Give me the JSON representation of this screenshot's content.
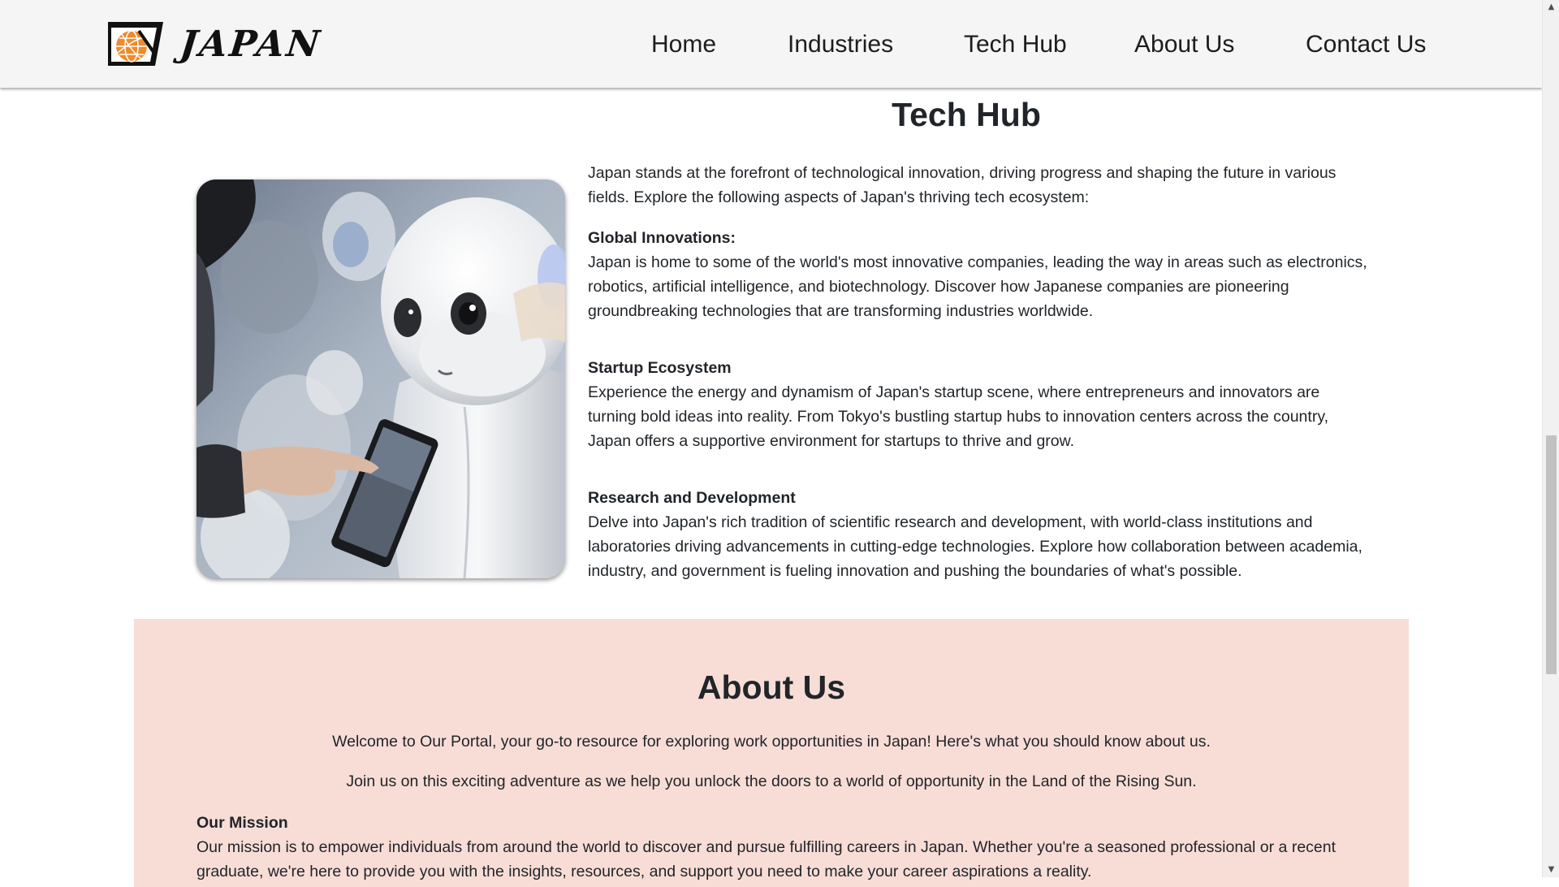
{
  "brand": {
    "name": "JAPAN",
    "logo_icon": "globe-logo-icon"
  },
  "nav": {
    "items": [
      {
        "label": "Home"
      },
      {
        "label": "Industries"
      },
      {
        "label": "Tech Hub"
      },
      {
        "label": "About Us"
      },
      {
        "label": "Contact Us"
      }
    ]
  },
  "tech_hub": {
    "title": "Tech Hub",
    "image_icon": "robot-photo",
    "intro": "Japan stands at the forefront of technological innovation, driving progress and shaping the future in various fields. Explore the following aspects of Japan's thriving tech ecosystem:",
    "features": [
      {
        "title": "Global Innovations:",
        "text": "Japan is home to some of the world's most innovative companies, leading the way in areas such as electronics, robotics, artificial intelligence, and biotechnology. Discover how Japanese companies are pioneering groundbreaking technologies that are transforming industries worldwide."
      },
      {
        "title": "Startup Ecosystem",
        "text": "Experience the energy and dynamism of Japan's startup scene, where entrepreneurs and innovators are turning bold ideas into reality. From Tokyo's bustling startup hubs to innovation centers across the country, Japan offers a supportive environment for startups to thrive and grow."
      },
      {
        "title": "Research and Development",
        "text": "Delve into Japan's rich tradition of scientific research and development, with world-class institutions and laboratories driving advancements in cutting-edge technologies. Explore how collaboration between academia, industry, and government is fueling innovation and pushing the boundaries of what's possible."
      }
    ]
  },
  "about": {
    "title": "About Us",
    "welcome": "Welcome to Our Portal, your go-to resource for exploring work opportunities in Japan! Here's what you should know about us.",
    "join": "Join us on this exciting adventure as we help you unlock the doors to a world of opportunity in the Land of the Rising Sun.",
    "mission_title": "Our Mission",
    "mission_text": "Our mission is to empower individuals from around the world to discover and pursue fulfilling careers in Japan. Whether you're a seasoned professional or a recent graduate, we're here to provide you with the insights, resources, and support you need to make your career aspirations a reality."
  },
  "colors": {
    "navbar_bg": "#f5f5f5",
    "about_bg": "#f8ddd7",
    "text": "#212529",
    "logo_orange": "#f08a2a"
  }
}
